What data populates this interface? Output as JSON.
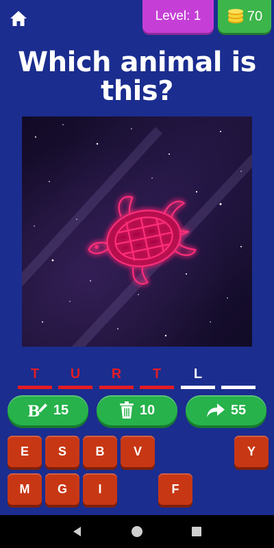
{
  "header": {
    "home_icon": "home-icon",
    "level_label": "Level: 1",
    "coins": "70",
    "coins_icon": "coins-icon"
  },
  "question": {
    "line1": "Which animal is",
    "line2": "this?"
  },
  "image": {
    "subject_icon": "turtle-icon",
    "accent_color": "#ff2e7a"
  },
  "answer": {
    "slots": [
      {
        "letter": "T",
        "state": "filled"
      },
      {
        "letter": "U",
        "state": "filled"
      },
      {
        "letter": "R",
        "state": "filled"
      },
      {
        "letter": "T",
        "state": "filled"
      },
      {
        "letter": "L",
        "state": "hint"
      },
      {
        "letter": "",
        "state": "empty"
      }
    ]
  },
  "powerups": [
    {
      "icon": "reveal-letter-icon",
      "cost": "15"
    },
    {
      "icon": "trash-icon",
      "cost": "10"
    },
    {
      "icon": "share-icon",
      "cost": "55"
    }
  ],
  "keyboard": {
    "row1": [
      "E",
      "S",
      "B",
      "V",
      "",
      "",
      "Y"
    ],
    "row2": [
      "M",
      "G",
      "I",
      "",
      "F",
      "",
      ""
    ]
  },
  "navbar": {
    "back_icon": "back-icon",
    "home_icon": "home-circle-icon",
    "recents_icon": "recents-icon"
  },
  "colors": {
    "background": "#1b2d8f",
    "level_badge": "#c53fd6",
    "coins_badge": "#3cb54a",
    "powerup": "#27b24b",
    "key": "#c83714",
    "answer_red": "#e51c24"
  }
}
